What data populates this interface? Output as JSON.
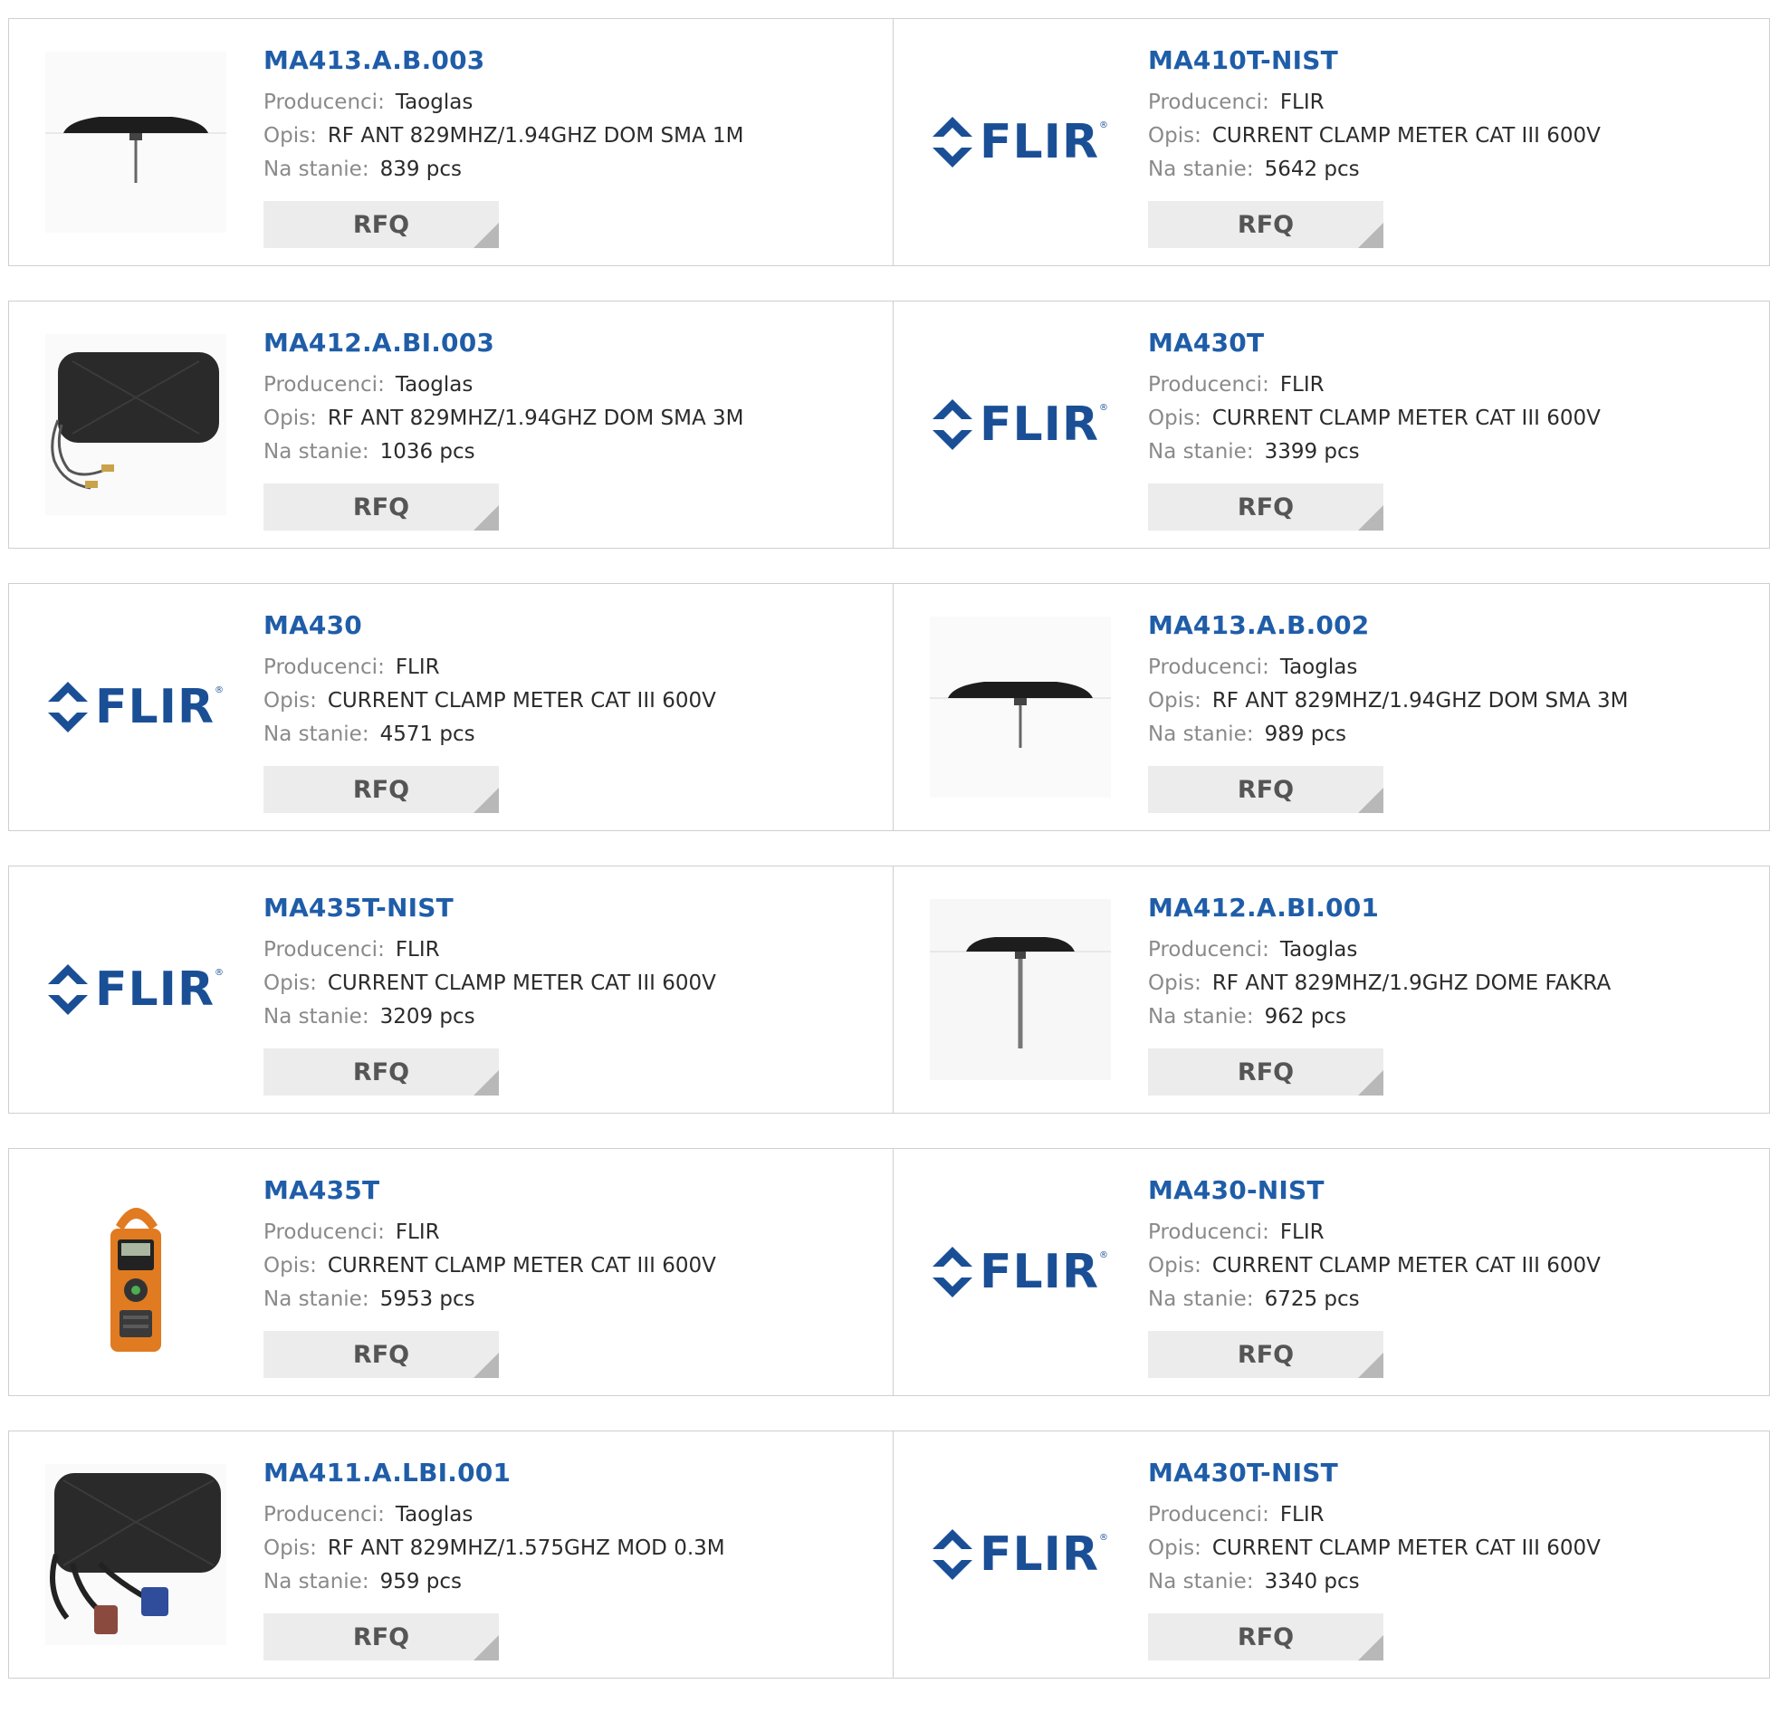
{
  "labels": {
    "manufacturer": "Producenci:",
    "description": "Opis:",
    "stock": "Na stanie:",
    "rfq": "RFQ"
  },
  "products": [
    {
      "part": "MA413.A.B.003",
      "manufacturer": "Taoglas",
      "description": "RF ANT 829MHZ/1.94GHZ DOM SMA 1M",
      "stock": "839 pcs",
      "image": "antenna-dome-icon"
    },
    {
      "part": "MA410T-NIST",
      "manufacturer": "FLIR",
      "description": "CURRENT CLAMP METER CAT III 600V",
      "stock": "5642 pcs",
      "image": "flir-logo"
    },
    {
      "part": "MA412.A.BI.003",
      "manufacturer": "Taoglas",
      "description": "RF ANT 829MHZ/1.94GHZ DOM SMA 3M",
      "stock": "1036 pcs",
      "image": "antenna-panel-icon"
    },
    {
      "part": "MA430T",
      "manufacturer": "FLIR",
      "description": "CURRENT CLAMP METER CAT III 600V",
      "stock": "3399 pcs",
      "image": "flir-logo"
    },
    {
      "part": "MA430",
      "manufacturer": "FLIR",
      "description": "CURRENT CLAMP METER CAT III 600V",
      "stock": "4571 pcs",
      "image": "flir-logo"
    },
    {
      "part": "MA413.A.B.002",
      "manufacturer": "Taoglas",
      "description": "RF ANT 829MHZ/1.94GHZ DOM SMA 3M",
      "stock": "989 pcs",
      "image": "antenna-dome-icon"
    },
    {
      "part": "MA435T-NIST",
      "manufacturer": "FLIR",
      "description": "CURRENT CLAMP METER CAT III 600V",
      "stock": "3209 pcs",
      "image": "flir-logo"
    },
    {
      "part": "MA412.A.BI.001",
      "manufacturer": "Taoglas",
      "description": "RF ANT 829MHZ/1.9GHZ DOME FAKRA",
      "stock": "962 pcs",
      "image": "antenna-mast-icon"
    },
    {
      "part": "MA435T",
      "manufacturer": "FLIR",
      "description": "CURRENT CLAMP METER CAT III 600V",
      "stock": "5953 pcs",
      "image": "clamp-meter-icon"
    },
    {
      "part": "MA430-NIST",
      "manufacturer": "FLIR",
      "description": "CURRENT CLAMP METER CAT III 600V",
      "stock": "6725 pcs",
      "image": "flir-logo"
    },
    {
      "part": "MA411.A.LBI.001",
      "manufacturer": "Taoglas",
      "description": "RF ANT 829MHZ/1.575GHZ MOD 0.3M",
      "stock": "959 pcs",
      "image": "antenna-panel-cables-icon"
    },
    {
      "part": "MA430T-NIST",
      "manufacturer": "FLIR",
      "description": "CURRENT CLAMP METER CAT III 600V",
      "stock": "3340 pcs",
      "image": "flir-logo"
    }
  ],
  "flir_logo": {
    "text": "FLIR",
    "color": "#1a4f96"
  },
  "colors": {
    "part_link": "#1f5da8",
    "label": "#8a8a8a",
    "rfq_bg": "#ececec"
  }
}
